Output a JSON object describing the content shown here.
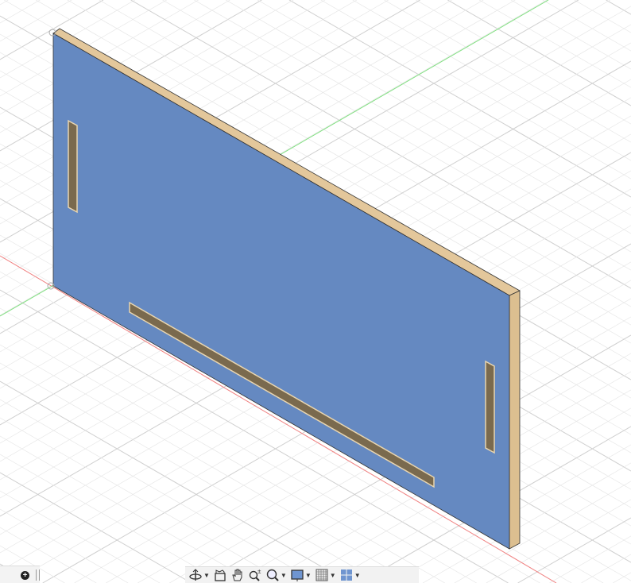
{
  "viewport": {
    "panel_face_color": "#6589c1",
    "panel_edge_color": "#e3c79b",
    "x_axis_color": "#f08080",
    "y_axis_color": "#7fe07f",
    "grid_color": "#dcdcdc"
  },
  "navigation_toolbar": {
    "items": [
      {
        "icon": "orbit-icon",
        "has_dropdown": true
      },
      {
        "icon": "look-at-icon",
        "has_dropdown": false
      },
      {
        "icon": "pan-hand-icon",
        "has_dropdown": false
      },
      {
        "icon": "zoom-icon",
        "has_dropdown": false
      },
      {
        "icon": "fit-window-icon",
        "has_dropdown": true
      },
      {
        "icon": "display-settings-icon",
        "has_dropdown": true
      },
      {
        "icon": "grid-snaps-icon",
        "has_dropdown": true
      },
      {
        "icon": "viewports-icon",
        "has_dropdown": true
      }
    ]
  },
  "left_bar": {
    "add_icon": "plus-circle-icon"
  }
}
